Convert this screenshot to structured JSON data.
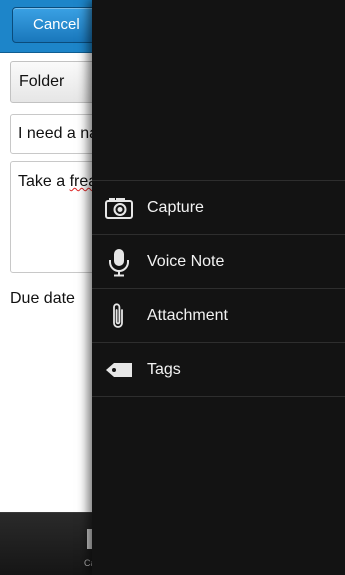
{
  "toolbar": {
    "cancel_label": "Cancel"
  },
  "form": {
    "folder_value": "Folder",
    "title_value": "I need a na",
    "notes_value_prefix": "Take a ",
    "notes_value_misspelled": "frea",
    "due_date_label": "Due date"
  },
  "bottom_bar": {
    "action_label": "Ca"
  },
  "menu": {
    "items": [
      {
        "label": "Capture",
        "icon": "camera-icon"
      },
      {
        "label": "Voice Note",
        "icon": "microphone-icon"
      },
      {
        "label": "Attachment",
        "icon": "paperclip-icon"
      },
      {
        "label": "Tags",
        "icon": "tag-icon"
      }
    ]
  },
  "colors": {
    "titlebar": "#1d85c9",
    "menu_background": "#131313",
    "menu_text": "#f2f2f2"
  }
}
